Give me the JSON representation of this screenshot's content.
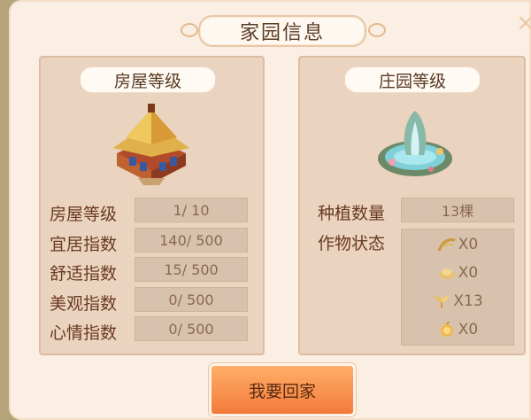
{
  "window": {
    "title": "家园信息",
    "close_icon": "close-icon"
  },
  "house": {
    "header": "房屋等级",
    "image_icon": "house-icon",
    "stats": [
      {
        "label": "房屋等级",
        "value": "1/ 10"
      },
      {
        "label": "宜居指数",
        "value": "140/ 500"
      },
      {
        "label": "舒适指数",
        "value": "15/ 500"
      },
      {
        "label": "美观指数",
        "value": "0/ 500"
      },
      {
        "label": "心情指数",
        "value": "0/ 500"
      }
    ]
  },
  "manor": {
    "header": "庄园等级",
    "image_icon": "fountain-icon",
    "plant_count_label": "种植数量",
    "plant_count_value": "13棵",
    "crop_status_label": "作物状态",
    "crops": [
      {
        "icon": "wilted-crop-icon",
        "count": "X0"
      },
      {
        "icon": "dry-crop-icon",
        "count": "X0"
      },
      {
        "icon": "sprout-icon",
        "count": "X13"
      },
      {
        "icon": "ripe-crop-icon",
        "count": "X0"
      }
    ]
  },
  "actions": {
    "return_home": "我要回家"
  },
  "colors": {
    "dialog_bg": "#fbeee3",
    "panel_bg": "#ead3bf",
    "button_orange": "#f27a3a",
    "text_brown": "#6a3a22"
  }
}
